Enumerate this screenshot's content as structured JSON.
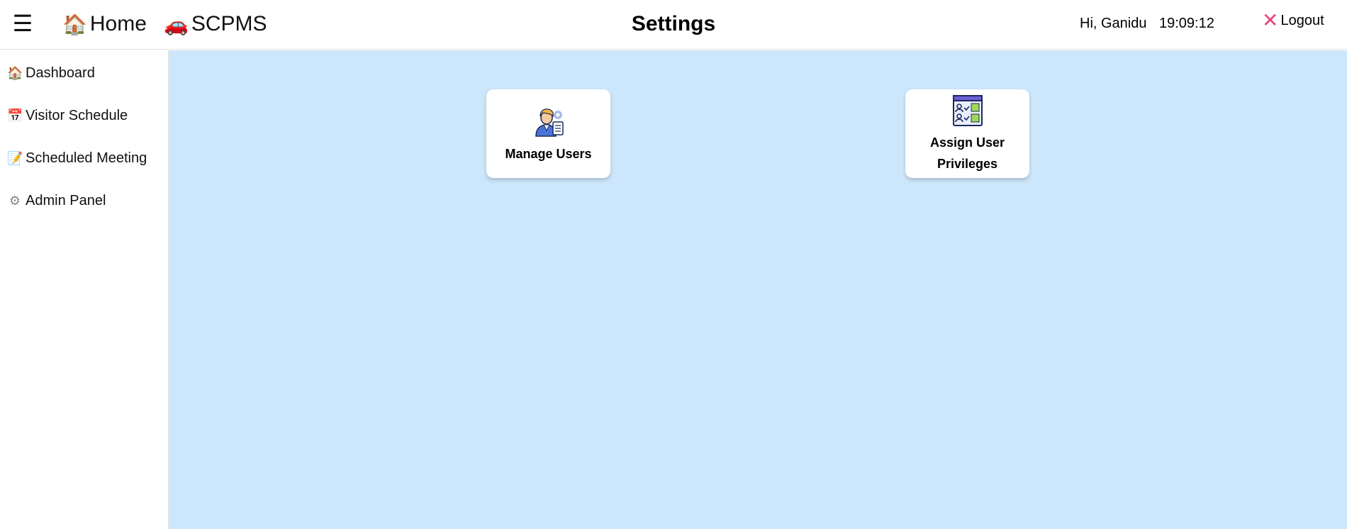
{
  "topbar": {
    "menu_icon": "hamburger-icon",
    "menu_glyph": "☰",
    "nav": [
      {
        "icon": "house-icon",
        "glyph": "🏠",
        "label": "Home"
      },
      {
        "icon": "car-icon",
        "glyph": "🚗",
        "label": "SCPMS"
      }
    ],
    "title": "Settings",
    "greeting": "Hi, Ganidu",
    "clock": "19:09:12",
    "logout": {
      "icon": "close-icon",
      "glyph": "✕",
      "label": "Logout",
      "icon_color": "#e8467c"
    }
  },
  "sidebar": {
    "items": [
      {
        "icon": "house-icon",
        "glyph": "🏠",
        "label": "Dashboard"
      },
      {
        "icon": "calendar-icon",
        "glyph": "📅",
        "label": "Visitor Schedule"
      },
      {
        "icon": "memo-icon",
        "glyph": "📝",
        "label": "Scheduled Meeting"
      },
      {
        "icon": "gear-icon",
        "glyph": "⚙",
        "label": "Admin Panel"
      }
    ]
  },
  "main": {
    "background": "#cce6fb",
    "cards": [
      {
        "icon": "manage-users-icon",
        "label": "Manage Users"
      },
      {
        "icon": "user-privileges-icon",
        "label": "Assign User Privileges"
      }
    ]
  }
}
